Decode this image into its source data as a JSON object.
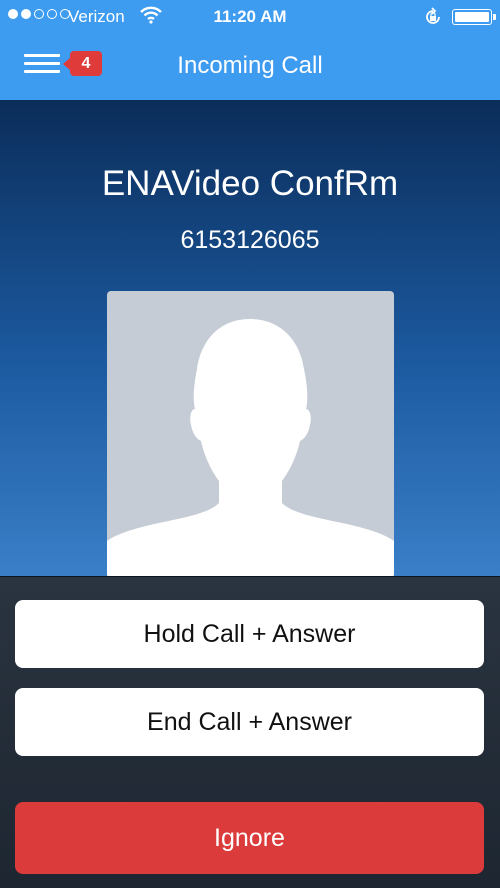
{
  "status_bar": {
    "carrier": "Verizon",
    "time": "11:20 AM",
    "signal_bars_filled": 2,
    "signal_bars_total": 5,
    "battery_level": 1.0
  },
  "header": {
    "title": "Incoming Call",
    "badge_count": "4"
  },
  "caller": {
    "name": "ENAVideo ConfRm",
    "number": "6153126065"
  },
  "actions": {
    "hold_answer": "Hold Call + Answer",
    "end_answer": "End Call + Answer",
    "ignore": "Ignore"
  },
  "colors": {
    "header_blue": "#3d9bf0",
    "badge_red": "#e03b3b",
    "ignore_red": "#dc3b3b"
  },
  "icons": [
    "wifi-icon",
    "rotation-lock-icon",
    "battery-icon",
    "menu-icon",
    "avatar-silhouette-icon"
  ]
}
